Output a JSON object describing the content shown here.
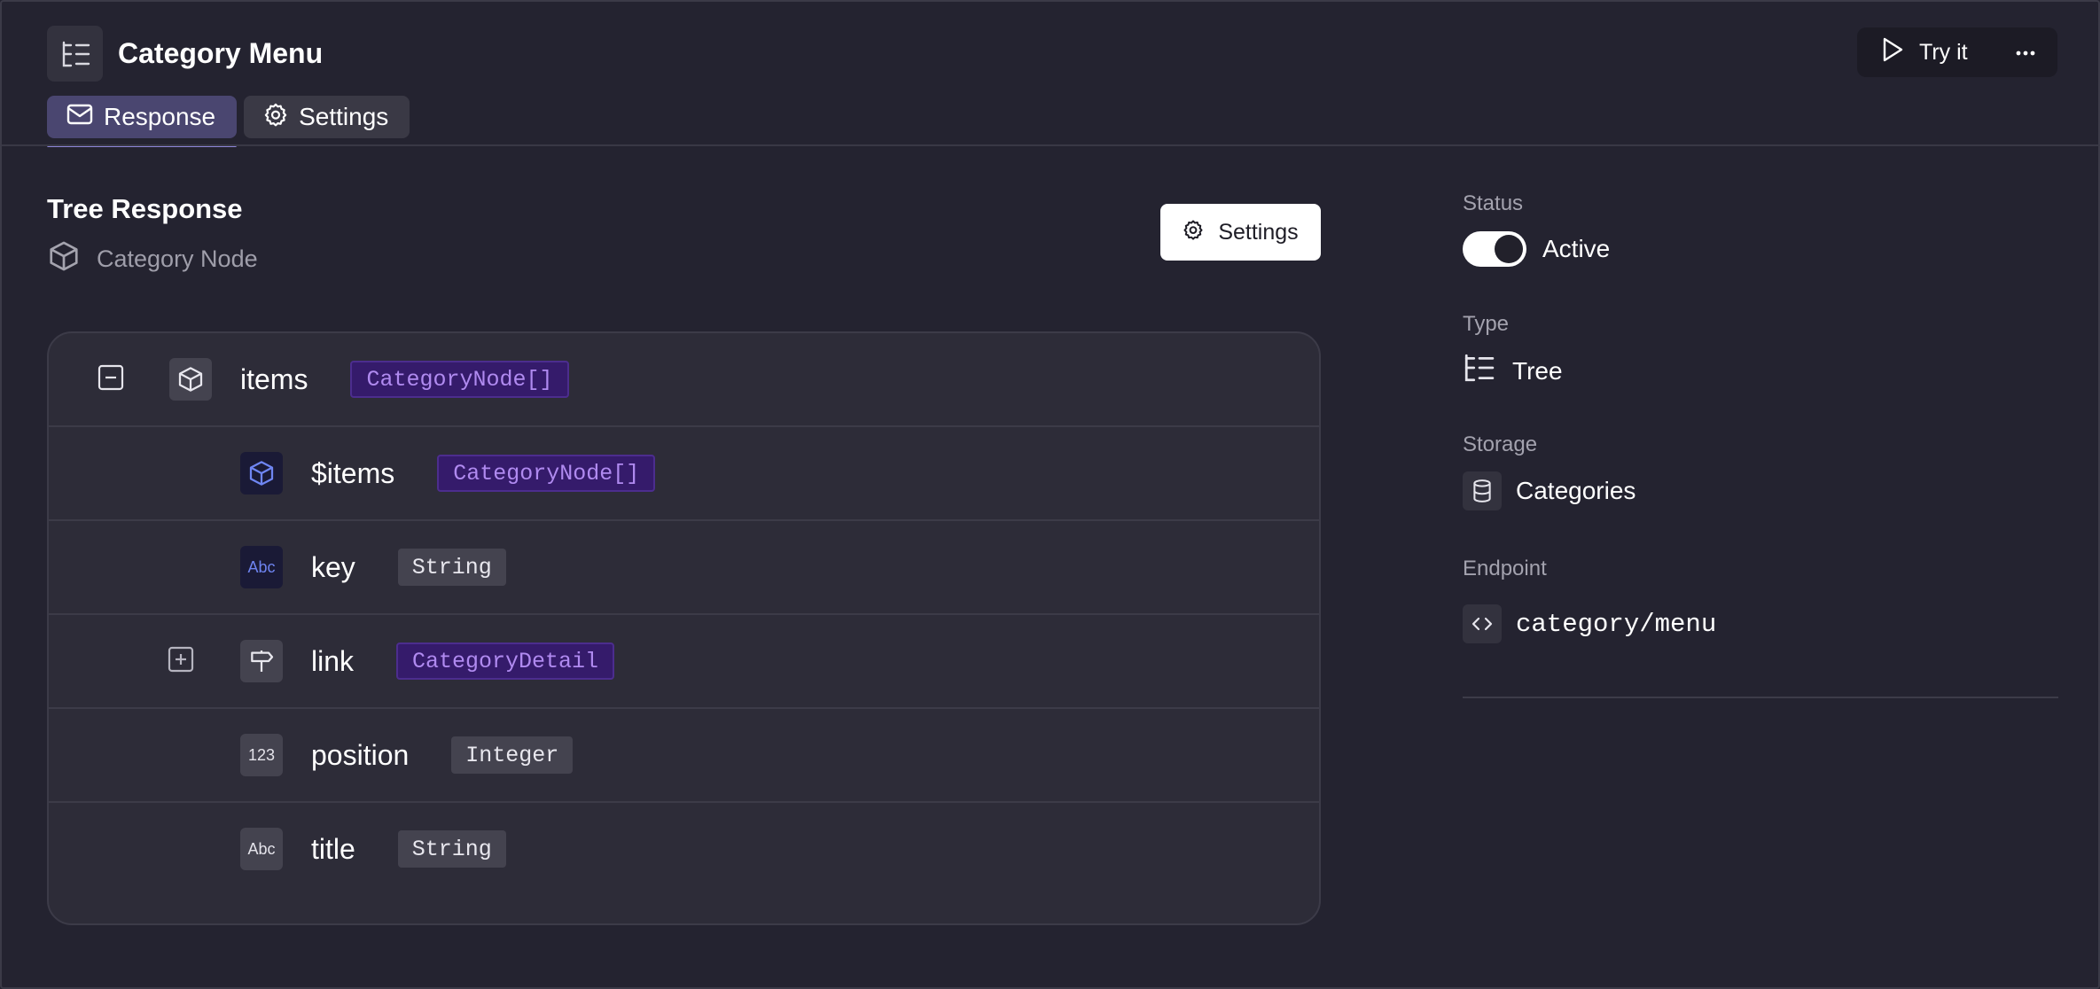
{
  "header": {
    "title": "Category Menu",
    "try_label": "Try it",
    "more_label": "···",
    "tabs": [
      {
        "label": "Response",
        "icon": "mail-icon",
        "active": true
      },
      {
        "label": "Settings",
        "icon": "gear-icon",
        "active": false
      }
    ]
  },
  "main": {
    "title": "Tree Response",
    "subtitle": "Category Node",
    "settings_label": "Settings",
    "rows": [
      {
        "name": "items",
        "type": "CategoryNode[]",
        "icon": "cube-icon",
        "toggle": "collapse"
      },
      {
        "name": "$items",
        "type": "CategoryNode[]",
        "icon": "cube-icon"
      },
      {
        "name": "key",
        "type": "String",
        "icon": "text-icon",
        "icon_text": "Abc"
      },
      {
        "name": "link",
        "type": "CategoryDetail",
        "icon": "signpost-icon",
        "toggle": "expand"
      },
      {
        "name": "position",
        "type": "Integer",
        "icon": "number-icon",
        "icon_text": "123"
      },
      {
        "name": "title",
        "type": "String",
        "icon": "text-icon",
        "icon_text": "Abc"
      }
    ]
  },
  "sidebar": {
    "status": {
      "label": "Status",
      "value": "Active",
      "enabled": true
    },
    "type": {
      "label": "Type",
      "value": "Tree",
      "icon": "tree-icon"
    },
    "storage": {
      "label": "Storage",
      "value": "Categories",
      "icon": "database-icon"
    },
    "endpoint": {
      "label": "Endpoint",
      "value": "category/menu",
      "icon": "code-icon"
    }
  },
  "colors": {
    "background": "#242330",
    "card": "#2d2c38",
    "accent_tab": "#4a4670",
    "badge_purple_bg": "#351b6b",
    "badge_purple_text": "#b08af0",
    "badge_gray_bg": "#44434f"
  }
}
